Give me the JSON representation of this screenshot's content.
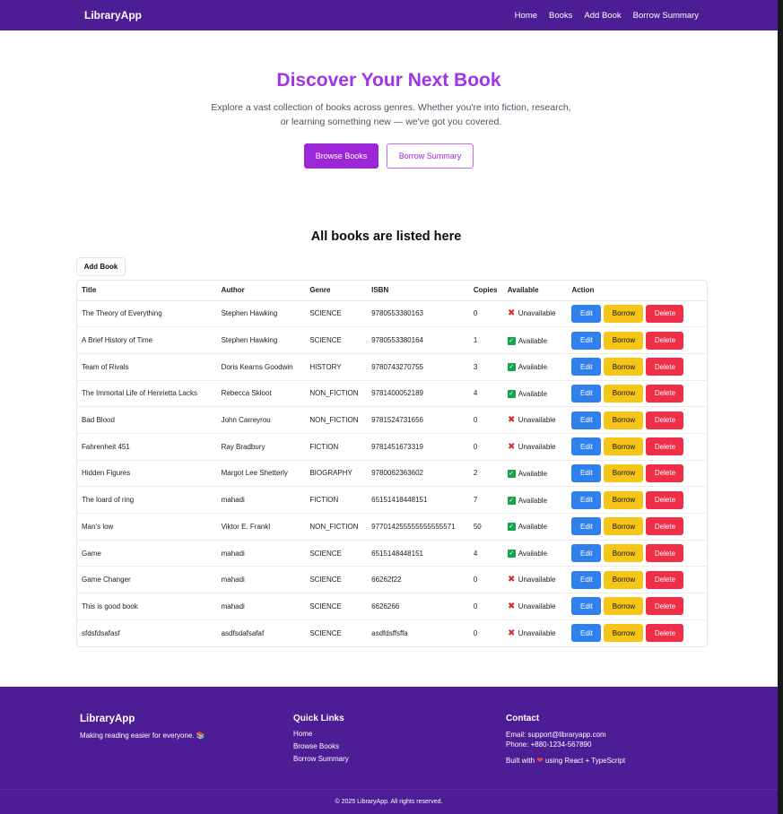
{
  "nav": {
    "brand": "LibraryApp",
    "links": [
      "Home",
      "Books",
      "Add Book",
      "Borrow Summary"
    ]
  },
  "hero": {
    "title": "Discover Your Next Book",
    "subtitle": "Explore a vast collection of books across genres. Whether you're into fiction, research, or learning something new — we've got you covered.",
    "primary_btn": "Browse Books",
    "secondary_btn": "Borrow Summary"
  },
  "books": {
    "title": "All books are listed here",
    "add_btn": "Add Book",
    "columns": [
      "Title",
      "Author",
      "Genre",
      "ISBN",
      "Copies",
      "Available",
      "Action"
    ],
    "action_labels": {
      "edit": "Edit",
      "borrow": "Borrow",
      "delete": "Delete"
    },
    "rows": [
      {
        "title": "The Theory of Everything",
        "author": "Stephen Hawking",
        "genre": "SCIENCE",
        "isbn": "9780553380163",
        "copies": "0",
        "available": false,
        "status": "Unavailable"
      },
      {
        "title": "A Brief History of Time",
        "author": "Stephen Hawking",
        "genre": "SCIENCE",
        "isbn": "9780553380164",
        "copies": "1",
        "available": true,
        "status": "Available"
      },
      {
        "title": "Team of Rivals",
        "author": "Doris Kearns Goodwin",
        "genre": "HISTORY",
        "isbn": "9780743270755",
        "copies": "3",
        "available": true,
        "status": "Available"
      },
      {
        "title": "The Immortal Life of Henrietta Lacks",
        "author": "Rebecca Skloot",
        "genre": "NON_FICTION",
        "isbn": "9781400052189",
        "copies": "4",
        "available": true,
        "status": "Available"
      },
      {
        "title": "Bad Blood",
        "author": "John Carreyrou",
        "genre": "NON_FICTION",
        "isbn": "9781524731656",
        "copies": "0",
        "available": false,
        "status": "Unavailable"
      },
      {
        "title": "Fahrenheit 451",
        "author": "Ray Bradbury",
        "genre": "FICTION",
        "isbn": "9781451673319",
        "copies": "0",
        "available": false,
        "status": "Unavailable"
      },
      {
        "title": "Hidden Figures",
        "author": "Margot Lee Shetterly",
        "genre": "BIOGRAPHY",
        "isbn": "9780062363602",
        "copies": "2",
        "available": true,
        "status": "Available"
      },
      {
        "title": "The loard of ring",
        "author": "mahadi",
        "genre": "FICTION",
        "isbn": "65151418448151",
        "copies": "7",
        "available": true,
        "status": "Available"
      },
      {
        "title": "Man's low",
        "author": "Viktor E. Frankl",
        "genre": "NON_FICTION",
        "isbn": "977014255555555555571",
        "copies": "50",
        "available": true,
        "status": "Available"
      },
      {
        "title": "Game",
        "author": "mahadi",
        "genre": "SCIENCE",
        "isbn": "6515148448151",
        "copies": "4",
        "available": true,
        "status": "Available"
      },
      {
        "title": "Game Changer",
        "author": "mahadi",
        "genre": "SCIENCE",
        "isbn": "66262f22",
        "copies": "0",
        "available": false,
        "status": "Unavailable"
      },
      {
        "title": "This is good book",
        "author": "mahadi",
        "genre": "SCIENCE",
        "isbn": "6626266",
        "copies": "0",
        "available": false,
        "status": "Unavailable"
      },
      {
        "title": "sfdsfdsafasf",
        "author": "asdfsdafsafaf",
        "genre": "SCIENCE",
        "isbn": "asdfdsffsffa",
        "copies": "0",
        "available": false,
        "status": "Unavailable"
      }
    ]
  },
  "footer": {
    "brand": "LibraryApp",
    "tagline": "Making reading easier for everyone.",
    "quick_links_title": "Quick Links",
    "quick_links": [
      "Home",
      "Browse Books",
      "Borrow Summary"
    ],
    "contact_title": "Contact",
    "email": "Email: support@libraryapp.com",
    "phone": "Phone: +880-1234-567890",
    "built_prefix": "Built with",
    "built_suffix": "using React + TypeScript",
    "copyright": "© 2025 LibraryApp. All rights reserved."
  },
  "colors": {
    "nav_bg": "#4c1d95",
    "accent": "#9c27d6",
    "edit": "#2f80ed",
    "borrow": "#f5c518",
    "delete": "#ef2e48",
    "available": "#16a34a",
    "unavailable": "#d32f2f"
  },
  "icons": {
    "available": "check-box-icon",
    "unavailable": "cross-mark-icon",
    "tagline": "books-icon",
    "built_with": "heart-icon"
  }
}
